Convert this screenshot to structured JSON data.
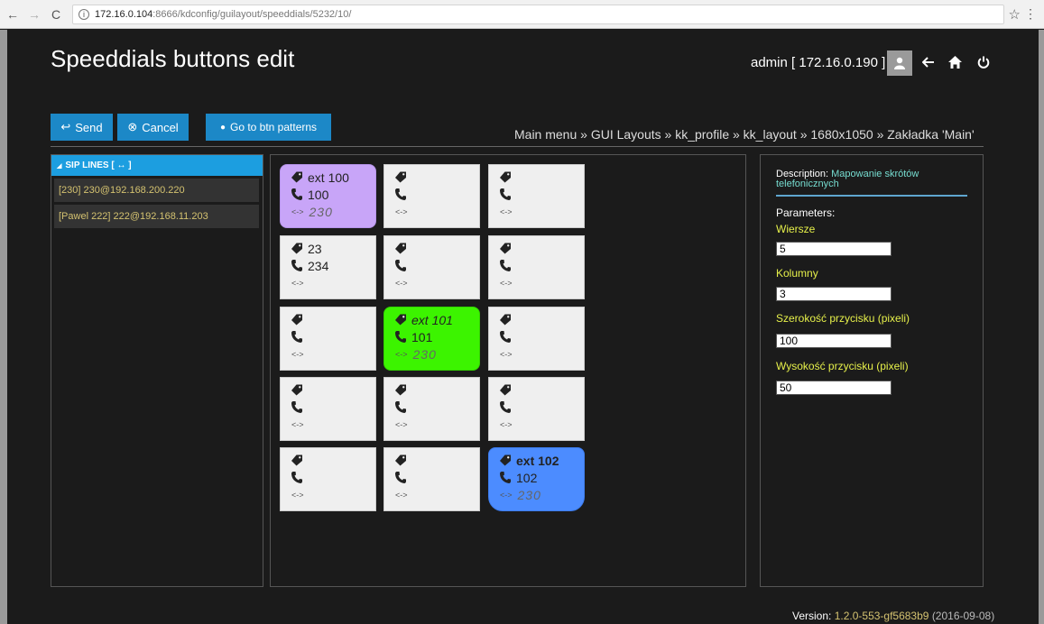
{
  "browser": {
    "back": "←",
    "forward": "→",
    "reload": "C",
    "url_host": "172.16.0.104",
    "url_path": ":8666/kdconfig/guilayout/speeddials/5232/10/",
    "star": "☆",
    "menu": "⋮"
  },
  "header": {
    "title": "Speeddials buttons edit",
    "user": "admin [ 172.16.0.190 ]"
  },
  "toolbar": {
    "send": "Send",
    "cancel": "Cancel",
    "patterns": "Go to btn patterns"
  },
  "breadcrumb": "Main menu » GUI Layouts » kk_profile » kk_layout » 1680x1050 » Zakładka 'Main'",
  "sip": {
    "header": "SIP LINES [ ↔ ]",
    "items": [
      "[230] 230@192.168.200.220",
      "[Pawel 222] 222@192.168.11.203"
    ]
  },
  "speeddials": [
    {
      "label": "ext 100",
      "number": "100",
      "line": "230",
      "style": "purple"
    },
    {
      "label": "",
      "number": "",
      "line": "",
      "style": "default"
    },
    {
      "label": "",
      "number": "",
      "line": "",
      "style": "default"
    },
    {
      "label": "23",
      "number": "234",
      "line": "",
      "style": "default"
    },
    {
      "label": "",
      "number": "",
      "line": "",
      "style": "default"
    },
    {
      "label": "",
      "number": "",
      "line": "",
      "style": "default"
    },
    {
      "label": "",
      "number": "",
      "line": "",
      "style": "default"
    },
    {
      "label": "ext 101",
      "number": "101",
      "line": "230",
      "style": "green"
    },
    {
      "label": "",
      "number": "",
      "line": "",
      "style": "default"
    },
    {
      "label": "",
      "number": "",
      "line": "",
      "style": "default"
    },
    {
      "label": "",
      "number": "",
      "line": "",
      "style": "default"
    },
    {
      "label": "",
      "number": "",
      "line": "",
      "style": "default"
    },
    {
      "label": "",
      "number": "",
      "line": "",
      "style": "default"
    },
    {
      "label": "",
      "number": "",
      "line": "",
      "style": "default"
    },
    {
      "label": "ext 102",
      "number": "102",
      "line": "230",
      "style": "blue"
    }
  ],
  "line_arrow": "<->",
  "details": {
    "desc_label": "Description:",
    "desc_value": "Mapowanie skrótów telefonicznych",
    "params_label": "Parameters:",
    "rows_label": "Wiersze",
    "rows_value": "5",
    "cols_label": "Kolumny",
    "cols_value": "3",
    "width_label": "Szerokość przycisku (pixeli)",
    "width_value": "100",
    "height_label": "Wysokość przycisku (pixeli)",
    "height_value": "50"
  },
  "version": {
    "label": "Version:",
    "value": "1.2.0-553-gf5683b9",
    "date": "(2016-09-08)"
  },
  "colors": {
    "accent": "#1c88c7",
    "purple": "#c8a5f8",
    "green": "#3cf400",
    "blue": "#4c8cff",
    "label_yellow": "#e6f04a",
    "sip_text": "#d4c270"
  }
}
